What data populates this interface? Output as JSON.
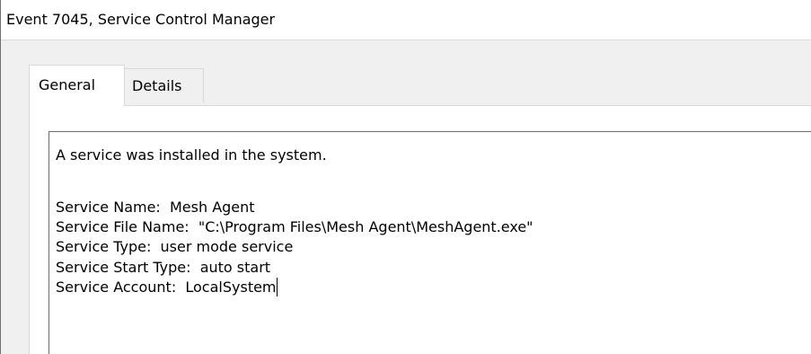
{
  "window": {
    "title": "Event 7045, Service Control Manager"
  },
  "tabs": [
    {
      "label": "General",
      "selected": true
    },
    {
      "label": "Details",
      "selected": false
    }
  ],
  "description": {
    "intro": "A service was installed in the system.",
    "service_name": "Service Name:  Mesh Agent",
    "service_file_name": "Service File Name:  \"C:\\Program Files\\Mesh Agent\\MeshAgent.exe\"",
    "service_type": "Service Type:  user mode service",
    "service_start_type": "Service Start Type:  auto start",
    "service_account": "Service Account:  LocalSystem"
  }
}
